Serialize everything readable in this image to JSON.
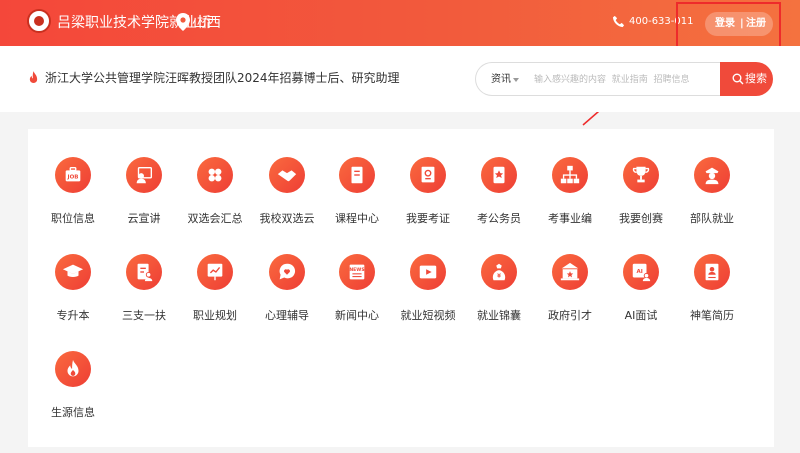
{
  "header": {
    "site_name": "吕梁职业技术学院就业桥",
    "location": "山西",
    "phone": "400-633-011",
    "login": "登录",
    "separator": "|",
    "register": "注册"
  },
  "headline": {
    "text": "浙江大学公共管理学院汪晖教授团队2024年招募博士后、研究助理"
  },
  "search": {
    "type": "资讯",
    "placeholder": "输入感兴趣的内容  就业指南  招聘信息",
    "button": "搜索"
  },
  "menu": [
    {
      "label": "职位信息",
      "icon": "job-icon"
    },
    {
      "label": "云宣讲",
      "icon": "presenter-icon"
    },
    {
      "label": "双选会汇总",
      "icon": "clover-icon"
    },
    {
      "label": "我校双选云",
      "icon": "handshake-icon"
    },
    {
      "label": "课程中心",
      "icon": "book-icon"
    },
    {
      "label": "我要考证",
      "icon": "certificate-icon"
    },
    {
      "label": "考公务员",
      "icon": "badge-icon"
    },
    {
      "label": "考事业编",
      "icon": "org-chart-icon"
    },
    {
      "label": "我要创赛",
      "icon": "trophy-icon"
    },
    {
      "label": "部队就业",
      "icon": "soldier-icon"
    },
    {
      "label": "专升本",
      "icon": "grad-cap-icon"
    },
    {
      "label": "三支一扶",
      "icon": "document-person-icon"
    },
    {
      "label": "职业规划",
      "icon": "chart-board-icon"
    },
    {
      "label": "心理辅导",
      "icon": "chat-heart-icon"
    },
    {
      "label": "新闻中心",
      "icon": "newspaper-icon"
    },
    {
      "label": "就业短视频",
      "icon": "video-icon"
    },
    {
      "label": "就业锦囊",
      "icon": "bag-icon"
    },
    {
      "label": "政府引才",
      "icon": "government-icon"
    },
    {
      "label": "AI面试",
      "icon": "ai-interview-icon"
    },
    {
      "label": "神笔简历",
      "icon": "resume-icon"
    },
    {
      "label": "生源信息",
      "icon": "flame-icon"
    }
  ],
  "colors": {
    "brand": "#f4473a",
    "icon_gradient_start": "#fa6a3e",
    "icon_gradient_end": "#ee3e35",
    "annotation": "#ee2b2b"
  }
}
